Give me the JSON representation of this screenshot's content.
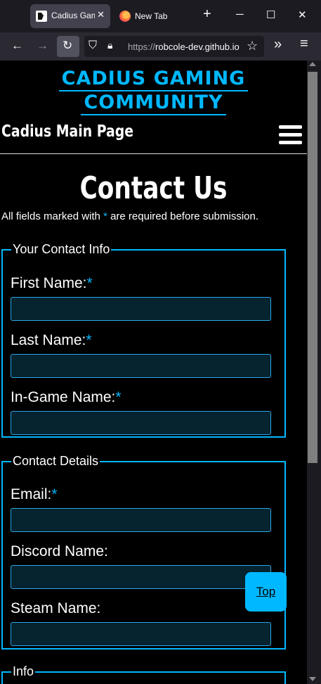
{
  "browser": {
    "active_tab_title": "Cadius Gaming Community",
    "second_tab_title": "New Tab",
    "url_scheme": "https://",
    "url_host": "robcole-dev.github.io",
    "tab_close": "✕",
    "new_tab": "+",
    "minimize": "─",
    "maximize": "☐",
    "close": "✕",
    "back": "←",
    "forward": "→",
    "reload": "↻",
    "shield": "⛉",
    "lock": "🔒︎",
    "bookmark_star": "☆",
    "overflow": "»",
    "menu": "≡"
  },
  "site": {
    "logo_line1": "CADIUS GAMING",
    "logo_line2": "COMMUNITY",
    "title": "Cadius Main Page",
    "brand_color": "#00b8ff"
  },
  "page": {
    "heading": "Contact Us",
    "note_before": "All fields marked with ",
    "note_star": "*",
    "note_after": " are required before submission."
  },
  "contact_info": {
    "legend": "Your Contact Info",
    "first_name_label": "First Name:",
    "last_name_label": "Last Name:",
    "ingame_name_label": "In-Game Name:",
    "required_mark": "*"
  },
  "contact_details": {
    "legend": "Contact Details",
    "email_label": "Email:",
    "discord_label": "Discord Name:",
    "steam_label": "Steam Name:",
    "required_mark": "*"
  },
  "info_section": {
    "legend": "Info"
  },
  "top_button": "Top"
}
